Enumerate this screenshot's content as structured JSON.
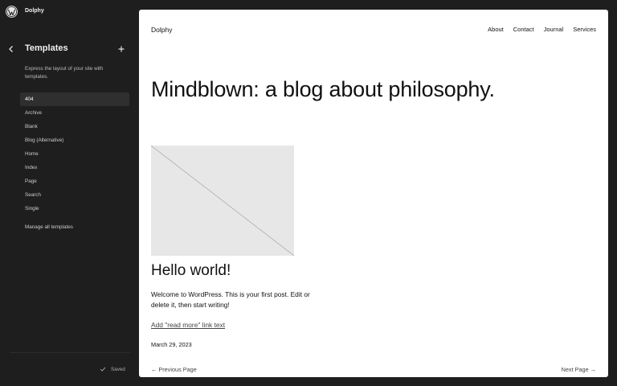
{
  "site": {
    "name": "Dolphy"
  },
  "sidebar": {
    "title": "Templates",
    "description": "Express the layout of your site with templates.",
    "items": [
      {
        "label": "404",
        "active": true
      },
      {
        "label": "Archive"
      },
      {
        "label": "Blank"
      },
      {
        "label": "Blog (Alternative)"
      },
      {
        "label": "Home"
      },
      {
        "label": "Index"
      },
      {
        "label": "Page"
      },
      {
        "label": "Search"
      },
      {
        "label": "Single"
      }
    ],
    "manage_label": "Manage all templates",
    "status_label": "Saved"
  },
  "preview": {
    "site_name": "Dolphy",
    "nav": [
      "About",
      "Contact",
      "Journal",
      "Services"
    ],
    "blog_title": "Mindblown: a blog about philosophy.",
    "post": {
      "title": "Hello world!",
      "excerpt": "Welcome to WordPress. This is your first post. Edit or delete it, then start writing!",
      "read_more": "Add \"read more\" link text",
      "date": "March 29, 2023"
    },
    "pagination": {
      "prev": "Previous Page",
      "next": "Next Page"
    }
  },
  "icons": [
    "wordpress-logo-icon",
    "chevron-left-icon",
    "plus-icon",
    "check-icon",
    "arrow-left-icon",
    "arrow-right-icon"
  ],
  "colors": {
    "sidebar_bg": "#1e1e1e",
    "active_item_bg": "#2f2f2f",
    "preview_bg": "#ffffff",
    "placeholder_bg": "#e7e7e7"
  }
}
